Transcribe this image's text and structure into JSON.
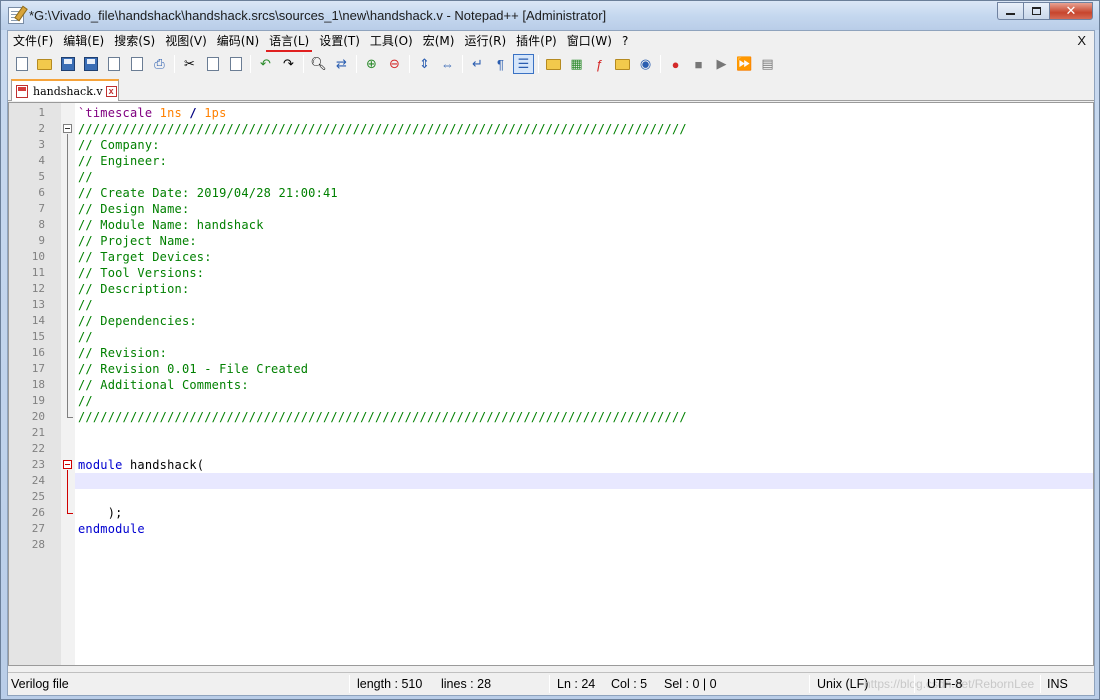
{
  "window": {
    "title": "*G:\\Vivado_file\\handshack\\handshack.srcs\\sources_1\\new\\handshack.v - Notepad++ [Administrator]",
    "close_glyph": "✕"
  },
  "menu": {
    "items": [
      "文件(F)",
      "编辑(E)",
      "搜索(S)",
      "视图(V)",
      "编码(N)",
      "语言(L)",
      "设置(T)",
      "工具(O)",
      "宏(M)",
      "运行(R)",
      "插件(P)",
      "窗口(W)",
      "?"
    ],
    "close_label": "X"
  },
  "toolbar": {
    "icons": [
      "new-file-icon",
      "open-file-icon",
      "save-icon",
      "save-all-icon",
      "close-icon",
      "close-all-icon",
      "print-icon",
      "cut-icon",
      "copy-icon",
      "paste-icon",
      "undo-icon",
      "redo-icon",
      "find-icon",
      "replace-icon",
      "zoom-in-icon",
      "zoom-out-icon",
      "sync-vertical-icon",
      "sync-horizontal-icon",
      "word-wrap-icon",
      "show-all-chars-icon",
      "indent-guide-icon",
      "user-language-icon",
      "doc-map-icon",
      "function-list-icon",
      "folder-workspace-icon",
      "monitoring-icon",
      "record-macro-icon",
      "stop-macro-icon",
      "play-macro-icon",
      "run-macro-multiple-icon",
      "save-macro-icon"
    ]
  },
  "tab": {
    "label": "handshack.v",
    "close_label": "x"
  },
  "editor": {
    "current_line": 24,
    "lines": [
      {
        "n": "1",
        "parts": [
          {
            "t": "`timescale ",
            "c": "c-dir"
          },
          {
            "t": "1ns",
            "c": "c-num"
          },
          {
            "t": " / ",
            "c": "c-op"
          },
          {
            "t": "1ps",
            "c": "c-num"
          }
        ]
      },
      {
        "n": "2",
        "parts": [
          {
            "t": "//////////////////////////////////////////////////////////////////////////////////",
            "c": "c-comment"
          }
        ]
      },
      {
        "n": "3",
        "parts": [
          {
            "t": "// Company:",
            "c": "c-comment"
          }
        ]
      },
      {
        "n": "4",
        "parts": [
          {
            "t": "// Engineer:",
            "c": "c-comment"
          }
        ]
      },
      {
        "n": "5",
        "parts": [
          {
            "t": "//",
            "c": "c-comment"
          }
        ]
      },
      {
        "n": "6",
        "parts": [
          {
            "t": "// Create Date: 2019/04/28 21:00:41",
            "c": "c-comment"
          }
        ]
      },
      {
        "n": "7",
        "parts": [
          {
            "t": "// Design Name:",
            "c": "c-comment"
          }
        ]
      },
      {
        "n": "8",
        "parts": [
          {
            "t": "// Module Name: handshack",
            "c": "c-comment"
          }
        ]
      },
      {
        "n": "9",
        "parts": [
          {
            "t": "// Project Name:",
            "c": "c-comment"
          }
        ]
      },
      {
        "n": "10",
        "parts": [
          {
            "t": "// Target Devices:",
            "c": "c-comment"
          }
        ]
      },
      {
        "n": "11",
        "parts": [
          {
            "t": "// Tool Versions:",
            "c": "c-comment"
          }
        ]
      },
      {
        "n": "12",
        "parts": [
          {
            "t": "// Description:",
            "c": "c-comment"
          }
        ]
      },
      {
        "n": "13",
        "parts": [
          {
            "t": "//",
            "c": "c-comment"
          }
        ]
      },
      {
        "n": "14",
        "parts": [
          {
            "t": "// Dependencies:",
            "c": "c-comment"
          }
        ]
      },
      {
        "n": "15",
        "parts": [
          {
            "t": "//",
            "c": "c-comment"
          }
        ]
      },
      {
        "n": "16",
        "parts": [
          {
            "t": "// Revision:",
            "c": "c-comment"
          }
        ]
      },
      {
        "n": "17",
        "parts": [
          {
            "t": "// Revision 0.01 - File Created",
            "c": "c-comment"
          }
        ]
      },
      {
        "n": "18",
        "parts": [
          {
            "t": "// Additional Comments:",
            "c": "c-comment"
          }
        ]
      },
      {
        "n": "19",
        "parts": [
          {
            "t": "//",
            "c": "c-comment"
          }
        ]
      },
      {
        "n": "20",
        "parts": [
          {
            "t": "//////////////////////////////////////////////////////////////////////////////////",
            "c": "c-comment"
          }
        ]
      },
      {
        "n": "21",
        "parts": []
      },
      {
        "n": "22",
        "parts": []
      },
      {
        "n": "23",
        "parts": [
          {
            "t": "module",
            "c": "c-kw"
          },
          {
            "t": " handshack(",
            "c": "c-plain"
          }
        ]
      },
      {
        "n": "24",
        "parts": []
      },
      {
        "n": "25",
        "parts": []
      },
      {
        "n": "26",
        "parts": [
          {
            "t": "    );",
            "c": "c-plain"
          }
        ]
      },
      {
        "n": "27",
        "parts": [
          {
            "t": "endmodule",
            "c": "c-kw"
          }
        ]
      },
      {
        "n": "28",
        "parts": []
      }
    ]
  },
  "status": {
    "file_type": "Verilog file",
    "length": "length : 510",
    "lines": "lines : 28",
    "ln": "Ln : 24",
    "col": "Col : 5",
    "sel": "Sel : 0 | 0",
    "eol": "Unix (LF)",
    "encoding": "UTF-8",
    "mode": "INS",
    "watermark": "https://blog.csdn.net/RebornLee"
  }
}
